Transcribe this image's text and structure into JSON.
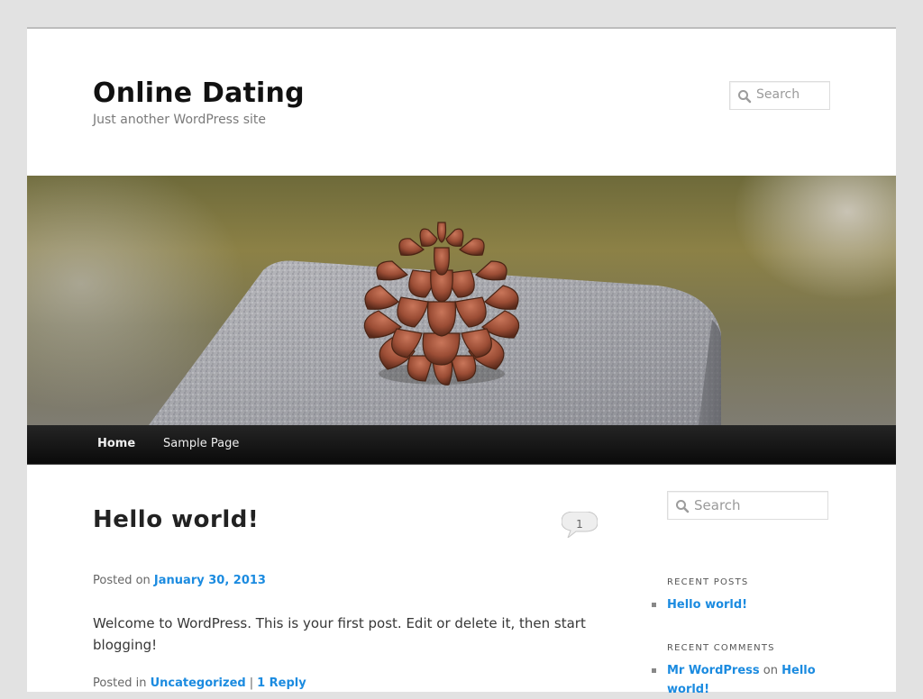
{
  "site": {
    "title": "Online Dating",
    "description": "Just another WordPress site"
  },
  "header_search": {
    "placeholder": "Search",
    "icon": "search-icon"
  },
  "banner": {
    "alt": "Pine cone on granite post",
    "icon": "header-image"
  },
  "nav": {
    "items": [
      {
        "label": "Home",
        "current": true
      },
      {
        "label": "Sample Page",
        "current": false
      }
    ]
  },
  "post": {
    "title": "Hello world!",
    "comment_count": "1",
    "meta_prefix": "Posted on",
    "date": "January 30, 2013",
    "content": "Welcome to WordPress. This is your first post. Edit or delete it, then start blogging!",
    "footer_prefix": "Posted in",
    "category": "Uncategorized",
    "separator": "|",
    "replies": "1 Reply"
  },
  "sidebar": {
    "search_placeholder": "Search",
    "recent_posts": {
      "title": "Recent Posts",
      "items": [
        "Hello world!"
      ]
    },
    "recent_comments": {
      "title": "Recent Comments",
      "items": [
        {
          "author": "Mr WordPress",
          "on": "on",
          "post": "Hello world!"
        }
      ]
    }
  },
  "colors": {
    "link": "#1b8be0",
    "nav_bg": "#111111",
    "page_bg": "#e2e2e2"
  }
}
